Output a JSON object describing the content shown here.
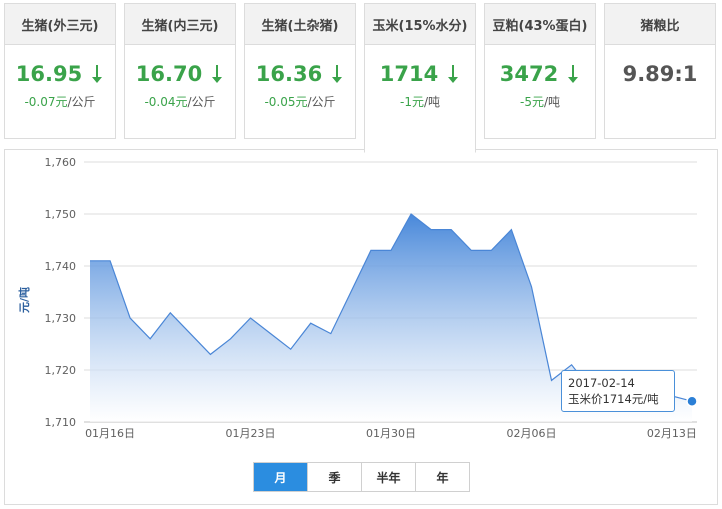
{
  "cards": [
    {
      "title": "生猪(外三元)",
      "value": "16.95",
      "direction": "down",
      "change": "-0.07元",
      "unit": "/公斤"
    },
    {
      "title": "生猪(内三元)",
      "value": "16.70",
      "direction": "down",
      "change": "-0.04元",
      "unit": "/公斤"
    },
    {
      "title": "生猪(土杂猪)",
      "value": "16.36",
      "direction": "down",
      "change": "-0.05元",
      "unit": "/公斤"
    },
    {
      "title": "玉米(15%水分)",
      "value": "1714",
      "direction": "down",
      "change": "-1元",
      "unit": "/吨"
    },
    {
      "title": "豆粕(43%蛋白)",
      "value": "3472",
      "direction": "down",
      "change": "-5元",
      "unit": "/吨"
    },
    {
      "title": "猪粮比",
      "value": "9.89:1",
      "direction": "none",
      "change": "",
      "unit": ""
    }
  ],
  "active_card": 3,
  "tooltip": {
    "date": "2017-02-14",
    "text": "玉米价1714元/吨"
  },
  "range_buttons": [
    {
      "label": "月",
      "active": true
    },
    {
      "label": "季",
      "active": false
    },
    {
      "label": "半年",
      "active": false
    },
    {
      "label": "年",
      "active": false
    }
  ],
  "colors": {
    "down": "#3aa34a",
    "line": "#4a86d6",
    "area_top": "#3f82d8",
    "area_bottom": "#ffffff",
    "accent": "#2b8de0"
  },
  "chart_data": {
    "type": "area",
    "ylabel": "元/吨",
    "ylim": [
      1710,
      1760
    ],
    "yticks": [
      1710,
      1720,
      1730,
      1740,
      1750,
      1760
    ],
    "ytick_labels": [
      "1,710",
      "1,720",
      "1,730",
      "1,740",
      "1,750",
      "1,760"
    ],
    "xlim": [
      "2017-01-15",
      "2017-02-14"
    ],
    "xtick_dates": [
      "2017-01-16",
      "2017-01-23",
      "2017-01-30",
      "2017-02-06",
      "2017-02-13"
    ],
    "xtick_labels": [
      "01月16日",
      "01月23日",
      "01月30日",
      "02月06日",
      "02月13日"
    ],
    "grid": true,
    "series": [
      {
        "name": "玉米价",
        "x": [
          "2017-01-15",
          "2017-01-16",
          "2017-01-17",
          "2017-01-18",
          "2017-01-19",
          "2017-01-20",
          "2017-01-21",
          "2017-01-22",
          "2017-01-23",
          "2017-01-24",
          "2017-01-25",
          "2017-01-26",
          "2017-01-27",
          "2017-01-28",
          "2017-01-29",
          "2017-01-30",
          "2017-01-31",
          "2017-02-01",
          "2017-02-02",
          "2017-02-03",
          "2017-02-04",
          "2017-02-05",
          "2017-02-06",
          "2017-02-07",
          "2017-02-08",
          "2017-02-09",
          "2017-02-10",
          "2017-02-11",
          "2017-02-12",
          "2017-02-13",
          "2017-02-14"
        ],
        "values": [
          1741,
          1741,
          1730,
          1726,
          1731,
          1727,
          1723,
          1726,
          1730,
          1727,
          1724,
          1729,
          1727,
          1735,
          1743,
          1743,
          1750,
          1747,
          1747,
          1743,
          1743,
          1747,
          1736,
          1718,
          1721,
          1716,
          1717,
          1715,
          1718,
          1715,
          1714
        ]
      }
    ]
  }
}
